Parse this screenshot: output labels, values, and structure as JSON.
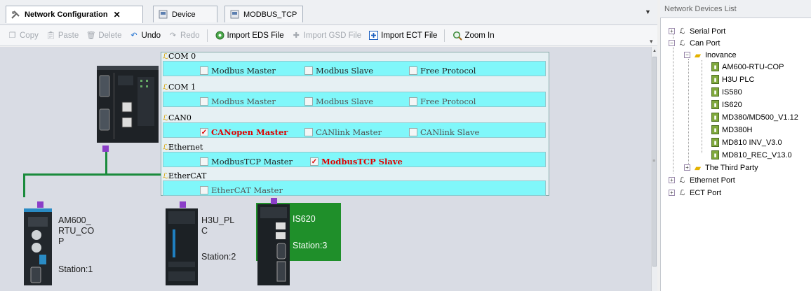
{
  "tabs": [
    {
      "label": "Network Configuration",
      "icon": "network-config-icon",
      "active": true
    },
    {
      "label": "Device",
      "icon": "device-icon",
      "active": false
    },
    {
      "label": "MODBUS_TCP",
      "icon": "modbus-icon",
      "active": false
    }
  ],
  "toolbar": {
    "copy": "Copy",
    "paste": "Paste",
    "delete": "Delete",
    "undo": "Undo",
    "redo": "Redo",
    "import_eds": "Import EDS File",
    "import_gsd": "Import GSD File",
    "import_ect": "Import ECT File",
    "zoom_in": "Zoom In"
  },
  "popup": {
    "groups": [
      {
        "title": "COM 0",
        "options": [
          {
            "label": "Modbus Master",
            "checked": false
          },
          {
            "label": "Modbus Slave",
            "checked": false
          },
          {
            "label": "Free Protocol",
            "checked": false
          }
        ]
      },
      {
        "title": "COM 1",
        "options": [
          {
            "label": "Modbus Master",
            "checked": false
          },
          {
            "label": "Modbus Slave",
            "checked": false
          },
          {
            "label": "Free Protocol",
            "checked": false
          }
        ]
      },
      {
        "title": "CAN0",
        "options": [
          {
            "label": "CANopen Master",
            "checked": true
          },
          {
            "label": "CANlink Master",
            "checked": false
          },
          {
            "label": "CANlink Slave",
            "checked": false
          }
        ]
      },
      {
        "title": "Ethernet",
        "options": [
          {
            "label": "ModbusTCP Master",
            "checked": false
          },
          {
            "label": "ModbusTCP Slave",
            "checked": true
          }
        ]
      },
      {
        "title": "EtherCAT",
        "options": [
          {
            "label": "EtherCAT Master",
            "checked": false
          }
        ]
      }
    ]
  },
  "devices": {
    "am600": {
      "name": "AM600_\nRTU_CO\nP",
      "station": "Station:1"
    },
    "h3u": {
      "name": "H3U_PL\nC",
      "station": "Station:2"
    },
    "is620": {
      "name": "IS620",
      "station": "Station:3"
    }
  },
  "tree": {
    "title": "Network Devices List",
    "serial_port": "Serial Port",
    "can_port": "Can Port",
    "inovance": "Inovance",
    "devices": [
      "AM600-RTU-COP",
      "H3U PLC",
      "IS580",
      "IS620",
      "MD380/MD500_V1.12",
      "MD380H",
      "MD810 INV_V3.0",
      "MD810_REC_V13.0"
    ],
    "third_party": "The Third Party",
    "ethernet_port": "Ethernet Port",
    "ect_port": "ECT Port"
  },
  "colors": {
    "bus": "#1a8b3c",
    "port": "#8b3ec8",
    "popup_row": "#80f7fa",
    "selected_device": "#1f8f2a",
    "checked_text": "#e00000"
  }
}
